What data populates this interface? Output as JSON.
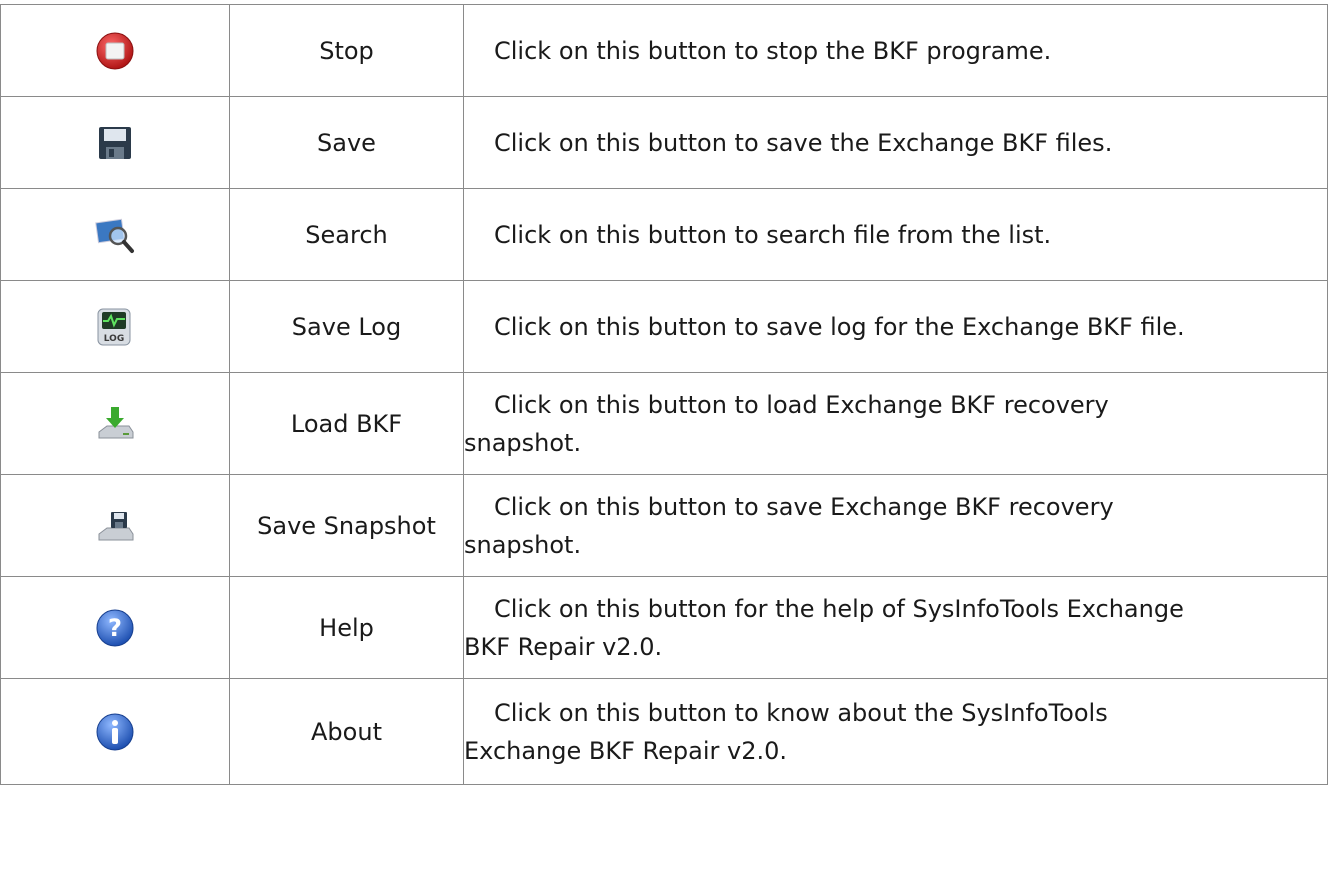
{
  "rows": [
    {
      "icon": "stop-icon",
      "name": "Stop",
      "description": [
        "Click on this button to stop the BKF programe."
      ]
    },
    {
      "icon": "save-disk-icon",
      "name": "Save",
      "description": [
        "Click on this button to save the Exchange BKF files."
      ]
    },
    {
      "icon": "search-icon",
      "name": "Search",
      "description": [
        "Click on this button to search file from the list."
      ]
    },
    {
      "icon": "save-log-icon",
      "name": "Save Log",
      "description": [
        "Click on this button to save log for the Exchange BKF file."
      ]
    },
    {
      "icon": "load-bkf-icon",
      "name": "Load BKF",
      "description": [
        "Click on this button to load Exchange BKF recovery",
        "snapshot."
      ]
    },
    {
      "icon": "save-snapshot-icon",
      "name": "Save Snapshot",
      "description": [
        "Click on this button to save Exchange BKF recovery",
        "snapshot."
      ]
    },
    {
      "icon": "help-icon",
      "name": "Help",
      "description": [
        "Click on this button for the help of SysInfoTools Exchange",
        "BKF Repair v2.0."
      ]
    },
    {
      "icon": "info-icon",
      "name": "About",
      "description": [
        "Click on this button to know about the SysInfoTools",
        "Exchange BKF Repair v2.0."
      ]
    }
  ],
  "colors": {
    "border": "#8a8a8a",
    "stop_red": "#d62b2b",
    "disk_dark": "#2b3a4a",
    "help_blue": "#2f6fd6",
    "arrow_green": "#3aaa2e"
  }
}
